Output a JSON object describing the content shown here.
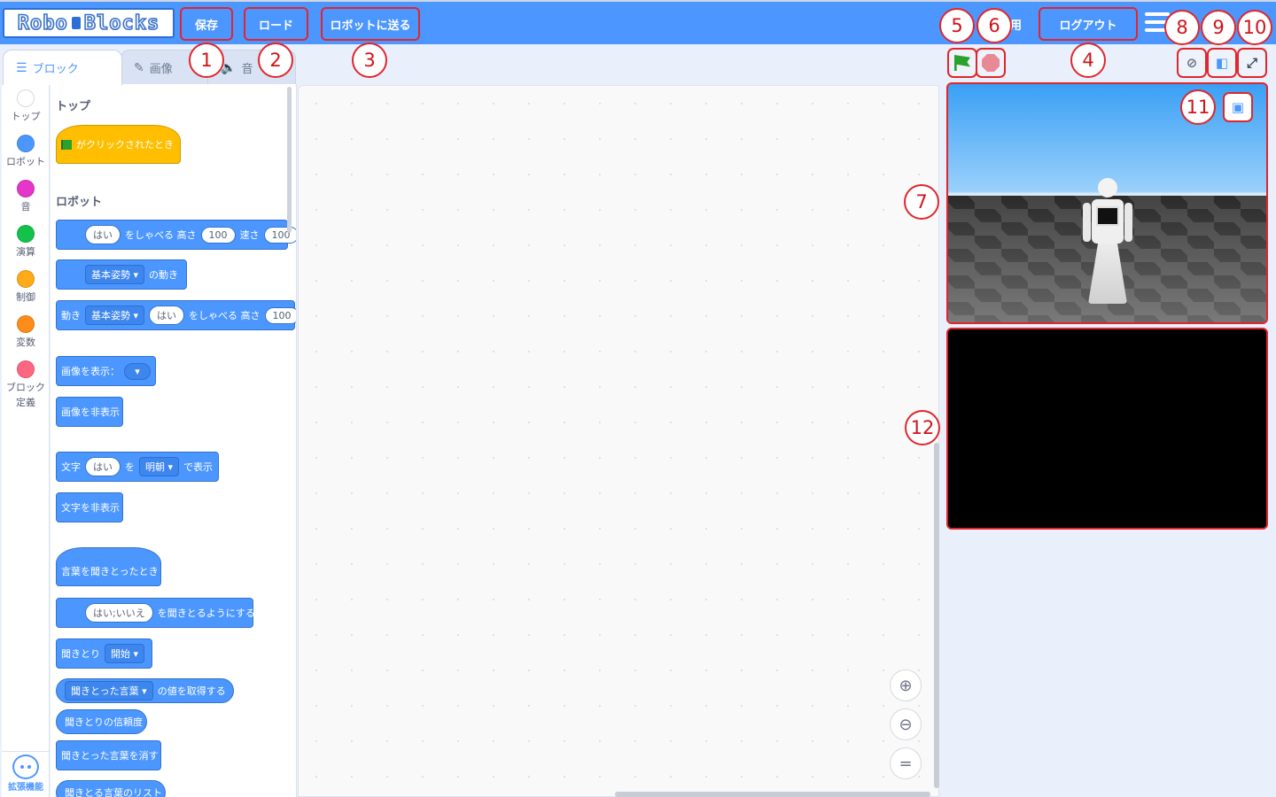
{
  "app": {
    "logo": {
      "word1": "Robo",
      "word2": "Blocks"
    }
  },
  "toolbar": {
    "save_label": "保存",
    "load_label": "ロード",
    "send_label": "ロボットに送る",
    "logout_label": "ログアウト",
    "partial_label": "用"
  },
  "tabs": [
    {
      "label": "ブロック",
      "icon": "blocks-icon"
    },
    {
      "label": "画像",
      "icon": "brush-icon"
    },
    {
      "label": "音",
      "icon": "speaker-icon"
    }
  ],
  "categories": [
    {
      "label": "トップ",
      "color": "#ffffff"
    },
    {
      "label": "ロボット",
      "color": "#4c97ff"
    },
    {
      "label": "音",
      "color": "#e636c9"
    },
    {
      "label": "演算",
      "color": "#13c24b"
    },
    {
      "label": "制御",
      "color": "#ffab19"
    },
    {
      "label": "変数",
      "color": "#ff8c1a"
    },
    {
      "label": "ブロック",
      "label2": "定義",
      "color": "#ff6680"
    }
  ],
  "extension": {
    "label": "拡張機能"
  },
  "palette": {
    "top_heading": "トップ",
    "flag_block": "がクリックされたとき",
    "robot_heading": "ロボット",
    "say": {
      "value": "はい",
      "label1": "をしゃべる 高さ",
      "height": "100",
      "label2": "速さ",
      "speed": "100"
    },
    "motion": {
      "dropdown": "基本姿勢",
      "label": "の動き"
    },
    "motion_say": {
      "label1": "動き",
      "dropdown": "基本姿勢",
      "value": "はい",
      "label2": "をしゃべる 高さ",
      "height": "100"
    },
    "show_image": {
      "label": "画像を表示："
    },
    "hide_image": {
      "label": "画像を非表示"
    },
    "show_text": {
      "label1": "文字",
      "value": "はい",
      "label2": "を",
      "font": "明朝",
      "label3": "で表示"
    },
    "hide_text": {
      "label": "文字を非表示"
    },
    "heard_hat": {
      "label": "言葉を聞きとったとき"
    },
    "listen_for": {
      "value": "はい;いいえ",
      "label": "を聞きとるようにする"
    },
    "listen": {
      "label": "聞きとり",
      "dropdown": "開始"
    },
    "heard_value": {
      "dropdown": "聞きとった言葉",
      "label": "の値を取得する"
    },
    "confidence": {
      "label": "聞きとりの信頼度"
    },
    "clear_heard": {
      "label": "聞きとった言葉を消す"
    },
    "heard_list": {
      "label": "聞きとる言葉のリスト"
    }
  },
  "zoom": {
    "in_icon": "zoom-in-icon",
    "out_icon": "zoom-out-icon",
    "reset_label": "="
  },
  "callouts": [
    "1",
    "2",
    "3",
    "4",
    "5",
    "6",
    "7",
    "8",
    "9",
    "10",
    "11",
    "12"
  ],
  "colors": {
    "brand": "#4c97ff",
    "annotation": "#e0262c"
  }
}
